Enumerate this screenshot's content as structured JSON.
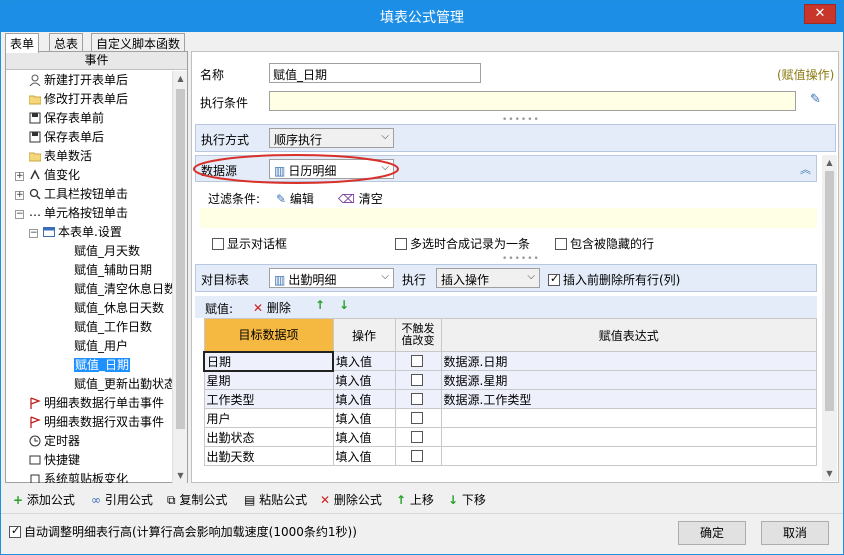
{
  "window": {
    "title": "填表公式管理",
    "close": "✕"
  },
  "tabs": [
    "表单",
    "总表",
    "自定义脚本函数"
  ],
  "left": {
    "header": "事件",
    "items": [
      {
        "label": "新建打开表单后",
        "icon": "new-form-icon"
      },
      {
        "label": "修改打开表单后",
        "icon": "folder-icon"
      },
      {
        "label": "保存表单前",
        "icon": "save-before-icon"
      },
      {
        "label": "保存表单后",
        "icon": "save-after-icon"
      },
      {
        "label": "表单数活",
        "icon": "folder-icon"
      },
      {
        "label": "值变化",
        "icon": "value-change-icon"
      },
      {
        "label": "工具栏按钮单击",
        "icon": "search-icon"
      },
      {
        "label": "单元格按钮单击",
        "icon": "dots-icon"
      },
      {
        "label": "本表单.设置",
        "icon": "form-icon"
      },
      {
        "label": "赋值_月天数"
      },
      {
        "label": "赋值_辅助日期"
      },
      {
        "label": "赋值_清空休息日数"
      },
      {
        "label": "赋值_休息日天数"
      },
      {
        "label": "赋值_工作日数"
      },
      {
        "label": "赋值_用户"
      },
      {
        "label": "赋值_日期"
      },
      {
        "label": "赋值_更新出勤状态"
      },
      {
        "label": "明细表数据行单击事件",
        "icon": "flag-icon"
      },
      {
        "label": "明细表数据行双击事件",
        "icon": "flag-icon"
      },
      {
        "label": "定时器",
        "icon": "timer-icon"
      },
      {
        "label": "快捷键",
        "icon": "shortcut-icon"
      },
      {
        "label": "系统剪贴板变化",
        "icon": "clipboard-icon"
      }
    ]
  },
  "form": {
    "name_label": "名称",
    "name_value": "赋值_日期",
    "op_tag": "(赋值操作)",
    "cond_label": "执行条件",
    "cond_value": "",
    "mode_label": "执行方式",
    "mode_value": "顺序执行",
    "source_label": "数据源",
    "source_value": "日历明细",
    "filter_label": "过滤条件:",
    "edit_label": "编辑",
    "clear_label": "清空",
    "opt1": "显示对话框",
    "opt2": "多选时合成记录为一条",
    "opt3": "包含被隐藏的行",
    "target_label": "对目标表",
    "target_value": "出勤明细",
    "exec_label": "执行",
    "exec_value": "插入操作",
    "delete_before_label": "插入前删除所有行(列)",
    "assign_label": "赋值:",
    "delete_label": "删除"
  },
  "grid": {
    "headers": [
      "目标数据项",
      "操作",
      "不触发值改变",
      "赋值表达式"
    ],
    "rows": [
      {
        "item": "日期",
        "op": "填入值",
        "expr": "数据源.日期"
      },
      {
        "item": "星期",
        "op": "填入值",
        "expr": "数据源.星期"
      },
      {
        "item": "工作类型",
        "op": "填入值",
        "expr": "数据源.工作类型"
      },
      {
        "item": "用户",
        "op": "填入值",
        "expr": ""
      },
      {
        "item": "出勤状态",
        "op": "填入值",
        "expr": ""
      },
      {
        "item": "出勤天数",
        "op": "填入值",
        "expr": ""
      }
    ]
  },
  "toolbar": {
    "add": "添加公式",
    "ref": "引用公式",
    "copy": "复制公式",
    "paste": "粘贴公式",
    "delete": "删除公式",
    "up": "上移",
    "down": "下移"
  },
  "footer": {
    "autofit": "自动调整明细表行高(计算行高会影响加载速度(1000条约1秒))",
    "ok": "确定",
    "cancel": "取消"
  }
}
